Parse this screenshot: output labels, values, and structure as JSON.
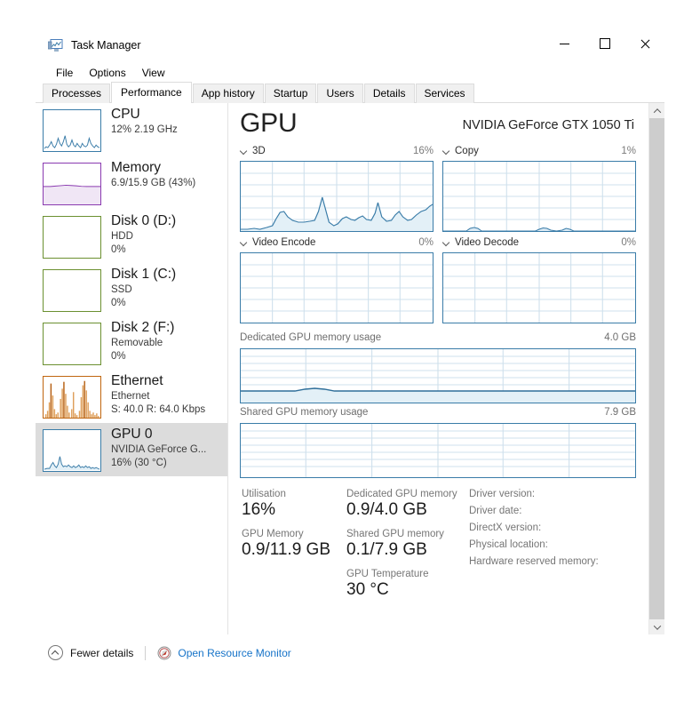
{
  "window": {
    "title": "Task Manager",
    "icon": "task-manager-icon",
    "controls": {
      "minimize": "Minimize",
      "maximize": "Maximize",
      "close": "Close"
    }
  },
  "menu": {
    "items": [
      "File",
      "Options",
      "View"
    ]
  },
  "tabs": {
    "items": [
      "Processes",
      "Performance",
      "App history",
      "Startup",
      "Users",
      "Details",
      "Services"
    ],
    "active": "Performance"
  },
  "sidebar": {
    "items": [
      {
        "name": "cpu",
        "title": "CPU",
        "line1": "12%  2.19 GHz",
        "line2": "",
        "selected": false,
        "color": "#3a7ca8"
      },
      {
        "name": "memory",
        "title": "Memory",
        "line1": "6.9/15.9 GB (43%)",
        "line2": "",
        "selected": false,
        "color": "#8a3ab0"
      },
      {
        "name": "disk0",
        "title": "Disk 0 (D:)",
        "line1": "HDD",
        "line2": "0%",
        "selected": false,
        "color": "#6b9030"
      },
      {
        "name": "disk1",
        "title": "Disk 1 (C:)",
        "line1": "SSD",
        "line2": "0%",
        "selected": false,
        "color": "#6b9030"
      },
      {
        "name": "disk2",
        "title": "Disk 2 (F:)",
        "line1": "Removable",
        "line2": "0%",
        "selected": false,
        "color": "#6b9030"
      },
      {
        "name": "ethernet",
        "title": "Ethernet",
        "line1": "Ethernet",
        "line2": "S: 40.0 R: 64.0 Kbps",
        "selected": false,
        "color": "#c0660f"
      },
      {
        "name": "gpu0",
        "title": "GPU 0",
        "line1": "NVIDIA GeForce G...",
        "line2": "16%  (30 °C)",
        "selected": true,
        "color": "#3a7ca8"
      }
    ]
  },
  "main": {
    "title": "GPU",
    "device": "NVIDIA GeForce GTX 1050 Ti",
    "engines": [
      {
        "name": "3d",
        "label": "3D",
        "value": "16%"
      },
      {
        "name": "copy",
        "label": "Copy",
        "value": "1%"
      },
      {
        "name": "video-encode",
        "label": "Video Encode",
        "value": "0%"
      },
      {
        "name": "video-decode",
        "label": "Video Decode",
        "value": "0%"
      }
    ],
    "memory_graphs": [
      {
        "name": "dedicated-gpu-memory-usage",
        "label": "Dedicated GPU memory usage",
        "max": "4.0 GB"
      },
      {
        "name": "shared-gpu-memory-usage",
        "label": "Shared GPU memory usage",
        "max": "7.9 GB"
      }
    ],
    "stats": {
      "col1": [
        {
          "label": "Utilisation",
          "value": "16%"
        },
        {
          "label": "GPU Memory",
          "value": "0.9/11.9 GB"
        }
      ],
      "col2": [
        {
          "label": "Dedicated GPU memory",
          "value": "0.9/4.0 GB"
        },
        {
          "label": "Shared GPU memory",
          "value": "0.1/7.9 GB"
        },
        {
          "label": "GPU Temperature",
          "value": "30 °C"
        }
      ],
      "col3": [
        "Driver version:",
        "Driver date:",
        "DirectX version:",
        "Physical location:",
        "Hardware reserved memory:"
      ]
    }
  },
  "footer": {
    "fewer_details": "Fewer details",
    "resource_monitor": "Open Resource Monitor"
  },
  "colors": {
    "accent_blue": "#3a7ca8",
    "link_blue": "#1673c8",
    "selected_bg": "#dcdcdc",
    "grid": "#cfe0ec"
  },
  "chart_data": [
    {
      "type": "area",
      "name": "3d-engine-graph",
      "title": "3D",
      "ylabel": "% utilisation",
      "ylim": [
        0,
        100
      ],
      "grid": true,
      "values": [
        2,
        2,
        2,
        2,
        3,
        2,
        2,
        3,
        2,
        2,
        4,
        14,
        22,
        24,
        22,
        18,
        12,
        9,
        8,
        8,
        7,
        8,
        7,
        8,
        9,
        34,
        30,
        16,
        5,
        4,
        5,
        4,
        10,
        12,
        8,
        6,
        7,
        11,
        13,
        10,
        8,
        7,
        6,
        8,
        10,
        26,
        22,
        10,
        5,
        6,
        8,
        14,
        16,
        12,
        7,
        6,
        8,
        12,
        18
      ]
    },
    {
      "type": "area",
      "name": "copy-engine-graph",
      "title": "Copy",
      "ylabel": "% utilisation",
      "ylim": [
        0,
        100
      ],
      "grid": true,
      "values": [
        0,
        0,
        0,
        0,
        0,
        0,
        0,
        0,
        1,
        2,
        2,
        1,
        0,
        0,
        0,
        0,
        0,
        0,
        0,
        0,
        0,
        0,
        0,
        0,
        0,
        0,
        0,
        0,
        0,
        0,
        1,
        2,
        1,
        0,
        0,
        1,
        2,
        2,
        1,
        0,
        0,
        0,
        0,
        0,
        1,
        1,
        0,
        0,
        0,
        0,
        0,
        0,
        0,
        0,
        0,
        0,
        0,
        0,
        0
      ]
    },
    {
      "type": "area",
      "name": "video-encode-graph",
      "title": "Video Encode",
      "ylabel": "% utilisation",
      "ylim": [
        0,
        100
      ],
      "grid": true,
      "values": [
        0,
        0,
        0,
        0,
        0,
        0,
        0,
        0,
        0,
        0,
        0,
        0,
        0,
        0,
        0,
        0,
        0,
        0,
        0,
        0,
        0,
        0,
        0,
        0,
        0,
        0,
        0,
        0,
        0,
        0,
        0,
        0,
        0,
        0,
        0,
        0,
        0,
        0,
        0,
        0
      ]
    },
    {
      "type": "area",
      "name": "video-decode-graph",
      "title": "Video Decode",
      "ylabel": "% utilisation",
      "ylim": [
        0,
        100
      ],
      "grid": true,
      "values": [
        0,
        0,
        0,
        0,
        0,
        0,
        0,
        0,
        0,
        0,
        0,
        0,
        0,
        0,
        0,
        0,
        0,
        0,
        0,
        0,
        0,
        0,
        0,
        0,
        0,
        0,
        0,
        0,
        0,
        0,
        0,
        0,
        0,
        0,
        0,
        0,
        0,
        0,
        0,
        0
      ]
    },
    {
      "type": "area",
      "name": "dedicated-gpu-memory-graph",
      "title": "Dedicated GPU memory usage",
      "ylabel": "GB",
      "ylim": [
        0,
        4.0
      ],
      "grid": true,
      "values": [
        0.85,
        0.85,
        0.85,
        0.86,
        0.86,
        0.86,
        0.87,
        0.9,
        0.95,
        0.97,
        0.95,
        0.9,
        0.88,
        0.87,
        0.86,
        0.86,
        0.86,
        0.86,
        0.86,
        0.86,
        0.86,
        0.86,
        0.86,
        0.86,
        0.86,
        0.86,
        0.86,
        0.86,
        0.86,
        0.86
      ]
    },
    {
      "type": "area",
      "name": "shared-gpu-memory-graph",
      "title": "Shared GPU memory usage",
      "ylabel": "GB",
      "ylim": [
        0,
        7.9
      ],
      "grid": true,
      "values": [
        0.1,
        0.1,
        0.1,
        0.1,
        0.1,
        0.1,
        0.1,
        0.1,
        0.1,
        0.1,
        0.1,
        0.1,
        0.1,
        0.1,
        0.1,
        0.1,
        0.1,
        0.1,
        0.1,
        0.1,
        0.1,
        0.1,
        0.1,
        0.1,
        0.1,
        0.1,
        0.1,
        0.1,
        0.1,
        0.1
      ]
    },
    {
      "type": "line",
      "name": "cpu-thumbnail-graph",
      "title": "CPU",
      "ylim": [
        0,
        100
      ],
      "values": [
        4,
        6,
        5,
        9,
        14,
        8,
        6,
        12,
        22,
        14,
        9,
        16,
        26,
        12,
        8,
        10,
        18,
        10,
        7,
        12,
        9,
        6,
        14,
        10,
        7,
        9,
        20,
        12,
        8,
        6,
        10,
        7,
        5,
        9,
        13,
        8,
        6,
        10,
        8,
        6
      ]
    },
    {
      "type": "area",
      "name": "memory-thumbnail-graph",
      "title": "Memory",
      "ylim": [
        0,
        100
      ],
      "values": [
        43,
        43,
        43,
        43,
        43,
        43,
        43,
        44,
        44,
        45,
        45,
        44,
        44,
        43,
        43,
        43,
        43,
        43,
        43,
        43,
        43,
        43,
        43,
        43,
        43,
        43,
        43,
        43,
        43,
        43
      ]
    },
    {
      "type": "area",
      "name": "ethernet-thumbnail-graph",
      "title": "Ethernet",
      "ylim": [
        0,
        100
      ],
      "values": [
        3,
        5,
        8,
        12,
        70,
        40,
        14,
        8,
        10,
        6,
        8,
        22,
        60,
        95,
        55,
        20,
        12,
        30,
        18,
        10,
        14,
        8,
        6,
        10,
        58,
        30,
        16,
        10,
        8,
        12,
        22,
        64,
        90,
        48,
        22,
        12,
        8,
        6,
        10,
        7
      ]
    }
  ]
}
